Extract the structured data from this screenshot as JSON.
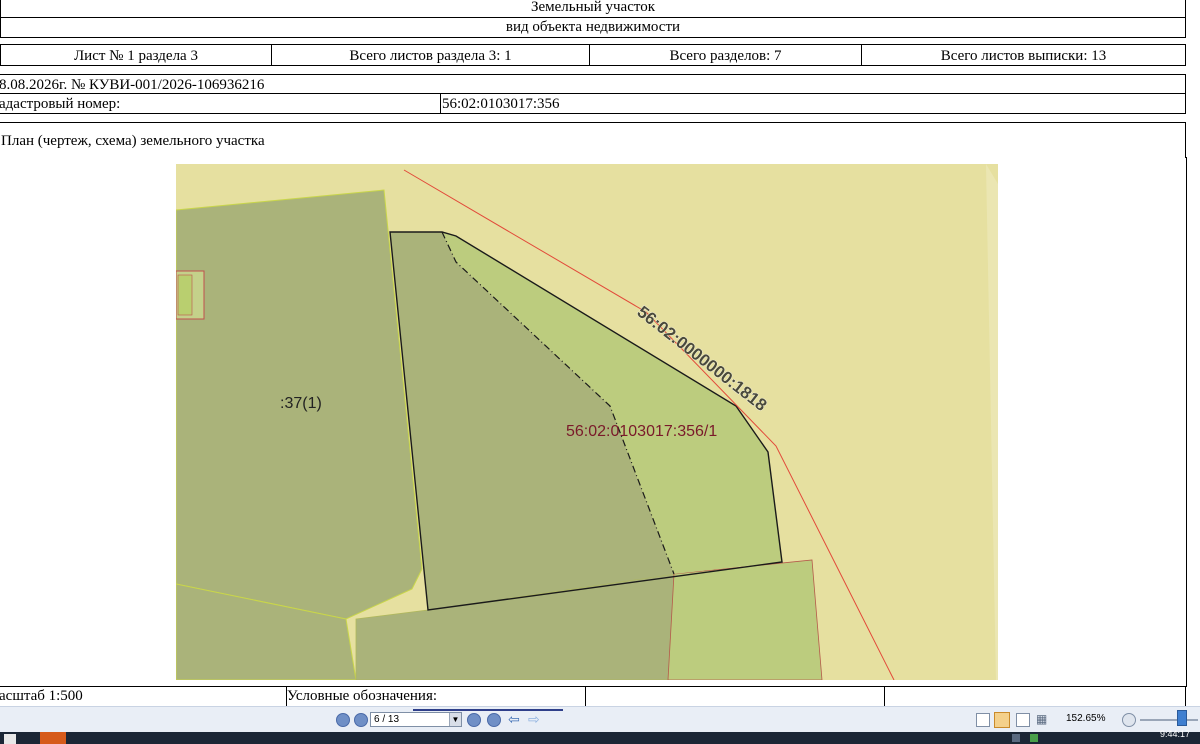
{
  "header": {
    "title": "Земельный участок",
    "subtitle": "вид объекта недвижимости"
  },
  "sheet_info": {
    "sheet": "Лист № 1 раздела 3",
    "total_sheets_section": "Всего листов раздела 3: 1",
    "total_sections": "Всего разделов: 7",
    "total_sheets_extract": "Всего листов выписки: 13"
  },
  "record": {
    "date_number": "8.08.2026г. № КУВИ-001/2026-106936216",
    "cadastral_label": "адастровый номер:",
    "cadastral_value": "56:02:0103017:356"
  },
  "plan": {
    "title": "План (чертеж, схема) земельного участка",
    "label_neighbor": ":37(1)",
    "label_part": "56:02:0103017:356/1",
    "label_road": "56:02:0000000:1818",
    "colors": {
      "background": "#e6e0a0",
      "parcel_dark": "#aab37a",
      "parcel_light": "#bccc7e",
      "boundary_red": "#e24a3a",
      "label_part": "#7a1a2a"
    }
  },
  "footer": {
    "scale": "асштаб 1:500",
    "legend": "Условные обозначения:"
  },
  "toolbar": {
    "page_value": "6 / 13",
    "zoom": "152.65%"
  },
  "taskbar": {
    "clock": "9:44:17"
  }
}
